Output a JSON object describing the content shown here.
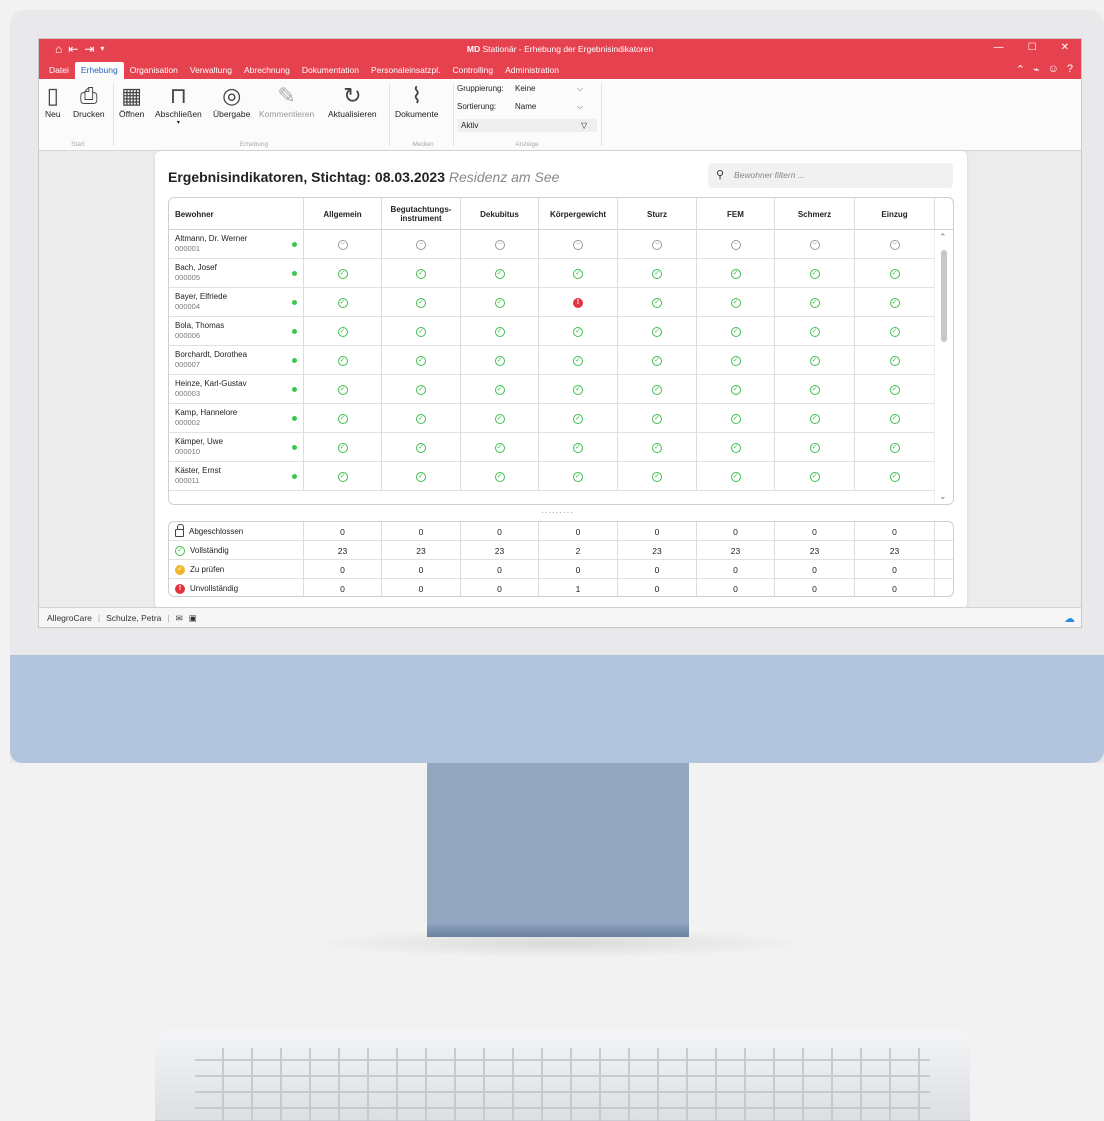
{
  "window": {
    "title_prefix": "MD",
    "title": "Stationär - Erhebung der Ergebnisindikatoren",
    "min": "—",
    "max": "☐",
    "close": "✕"
  },
  "menu": {
    "tabs": [
      "Datei",
      "Erhebung",
      "Organisation",
      "Verwaltung",
      "Abrechnung",
      "Dokumentation",
      "Personaleinsatzpl.",
      "Controlling",
      "Administration"
    ],
    "active": "Erhebung"
  },
  "ribbon": {
    "buttons": {
      "neu": "Neu",
      "drucken": "Drucken",
      "oeffnen": "Öffnen",
      "abschliessen": "Abschließen",
      "uebergabe": "Übergabe",
      "kommentieren": "Kommentieren",
      "aktualisieren": "Aktualisieren",
      "dokumente": "Dokumente"
    },
    "groups": {
      "start": "Start",
      "erhebung": "Erhebung",
      "medien": "Medien",
      "anzeige": "Anzeige"
    },
    "gruppierung": {
      "label": "Gruppierung:",
      "value": "Keine"
    },
    "sortierung": {
      "label": "Sortierung:",
      "value": "Name"
    },
    "filter_value": "Aktiv"
  },
  "card": {
    "title": "Ergebnisindikatoren, Stichtag: 08.03.2023",
    "subtitle": "Residenz am See",
    "search_placeholder": "Bewohner filtern ..."
  },
  "columns": [
    "Bewohner",
    "Allgemein",
    "Begutachtungs-instrument",
    "Dekubitus",
    "Körpergewicht",
    "Sturz",
    "FEM",
    "Schmerz",
    "Einzug"
  ],
  "residents": [
    {
      "name": "Altmann, Dr. Werner",
      "id": "000001",
      "status": [
        "none",
        "none",
        "none",
        "none",
        "none",
        "none",
        "none",
        "none"
      ]
    },
    {
      "name": "Bach, Josef",
      "id": "000005",
      "status": [
        "ok",
        "ok",
        "ok",
        "ok",
        "ok",
        "ok",
        "ok",
        "ok"
      ]
    },
    {
      "name": "Bayer, Elfriede",
      "id": "000004",
      "status": [
        "ok",
        "ok",
        "ok",
        "err",
        "ok",
        "ok",
        "ok",
        "ok"
      ]
    },
    {
      "name": "Bola, Thomas",
      "id": "000006",
      "status": [
        "ok",
        "ok",
        "ok",
        "ok",
        "ok",
        "ok",
        "ok",
        "ok"
      ]
    },
    {
      "name": "Borchardt, Dorothea",
      "id": "000007",
      "status": [
        "ok",
        "ok",
        "ok",
        "ok",
        "ok",
        "ok",
        "ok",
        "ok"
      ]
    },
    {
      "name": "Heinze, Karl-Gustav",
      "id": "000003",
      "status": [
        "ok",
        "ok",
        "ok",
        "ok",
        "ok",
        "ok",
        "ok",
        "ok"
      ]
    },
    {
      "name": "Kamp, Hannelore",
      "id": "000002",
      "status": [
        "ok",
        "ok",
        "ok",
        "ok",
        "ok",
        "ok",
        "ok",
        "ok"
      ]
    },
    {
      "name": "Kämper, Uwe",
      "id": "000010",
      "status": [
        "ok",
        "ok",
        "ok",
        "ok",
        "ok",
        "ok",
        "ok",
        "ok"
      ]
    },
    {
      "name": "Käster, Ernst",
      "id": "000011",
      "status": [
        "ok",
        "ok",
        "ok",
        "ok",
        "ok",
        "ok",
        "ok",
        "ok"
      ]
    }
  ],
  "summary": [
    {
      "label": "Abgeschlossen",
      "icon": "lock-icon",
      "values": [
        "0",
        "0",
        "0",
        "0",
        "0",
        "0",
        "0",
        "0"
      ]
    },
    {
      "label": "Vollständig",
      "icon": "check-circle-icon",
      "values": [
        "23",
        "23",
        "23",
        "2",
        "23",
        "23",
        "23",
        "23"
      ]
    },
    {
      "label": "Zu prüfen",
      "icon": "review-icon",
      "values": [
        "0",
        "0",
        "0",
        "0",
        "0",
        "0",
        "0",
        "0"
      ]
    },
    {
      "label": "Unvollständig",
      "icon": "error-icon",
      "values": [
        "0",
        "0",
        "0",
        "1",
        "0",
        "0",
        "0",
        "0"
      ]
    }
  ],
  "status": {
    "app": "AllegroCare",
    "user": "Schulze, Petra"
  },
  "colors": {
    "accent": "#e5414f",
    "ok": "#3fbf4f",
    "error": "#e2343f",
    "warning": "#f2b62c",
    "active_tab_text": "#2a63c2"
  }
}
